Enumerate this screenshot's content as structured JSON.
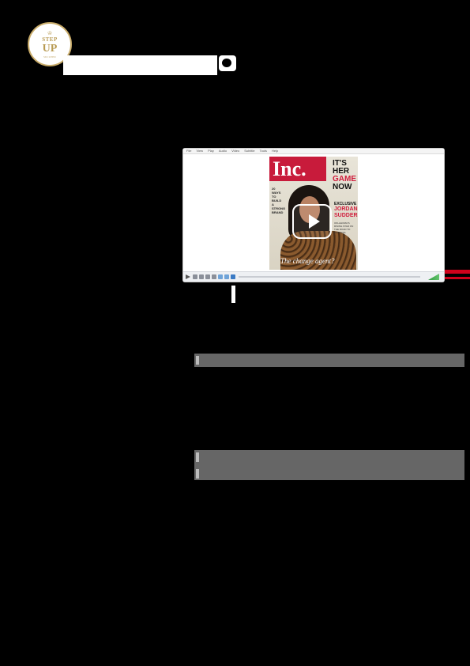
{
  "logo": {
    "line1": "STEP",
    "line2": "UP",
    "line3": "SUCCEED"
  },
  "player": {
    "menu": [
      "File",
      "View",
      "Play",
      "Audio",
      "Video",
      "Subtitle",
      "Tools",
      "Help"
    ]
  },
  "cover": {
    "masthead": "Inc.",
    "headline_line1": "IT'S",
    "headline_line2": "HER",
    "headline_line3": "GAME",
    "headline_line4": "NOW",
    "exclusive": "EXCLUSIVE",
    "name": "JORDAN SUDDERS",
    "small_text": "OKLAHOMA'S RISING STAR ON THE ROAD TO SUCCESS",
    "left_column": "20 WAYS TO BUILD A STRONG BRAND",
    "tagline": "The change agent?"
  },
  "colors": {
    "page_background": "#000000",
    "logo_gold": "#b89a52",
    "masthead_red": "#c81b3b",
    "bar_grey": "#666666",
    "accent_red": "#d0021b"
  },
  "icons": {
    "play_overlay": "play-icon",
    "logo_crown": "crown-icon"
  }
}
